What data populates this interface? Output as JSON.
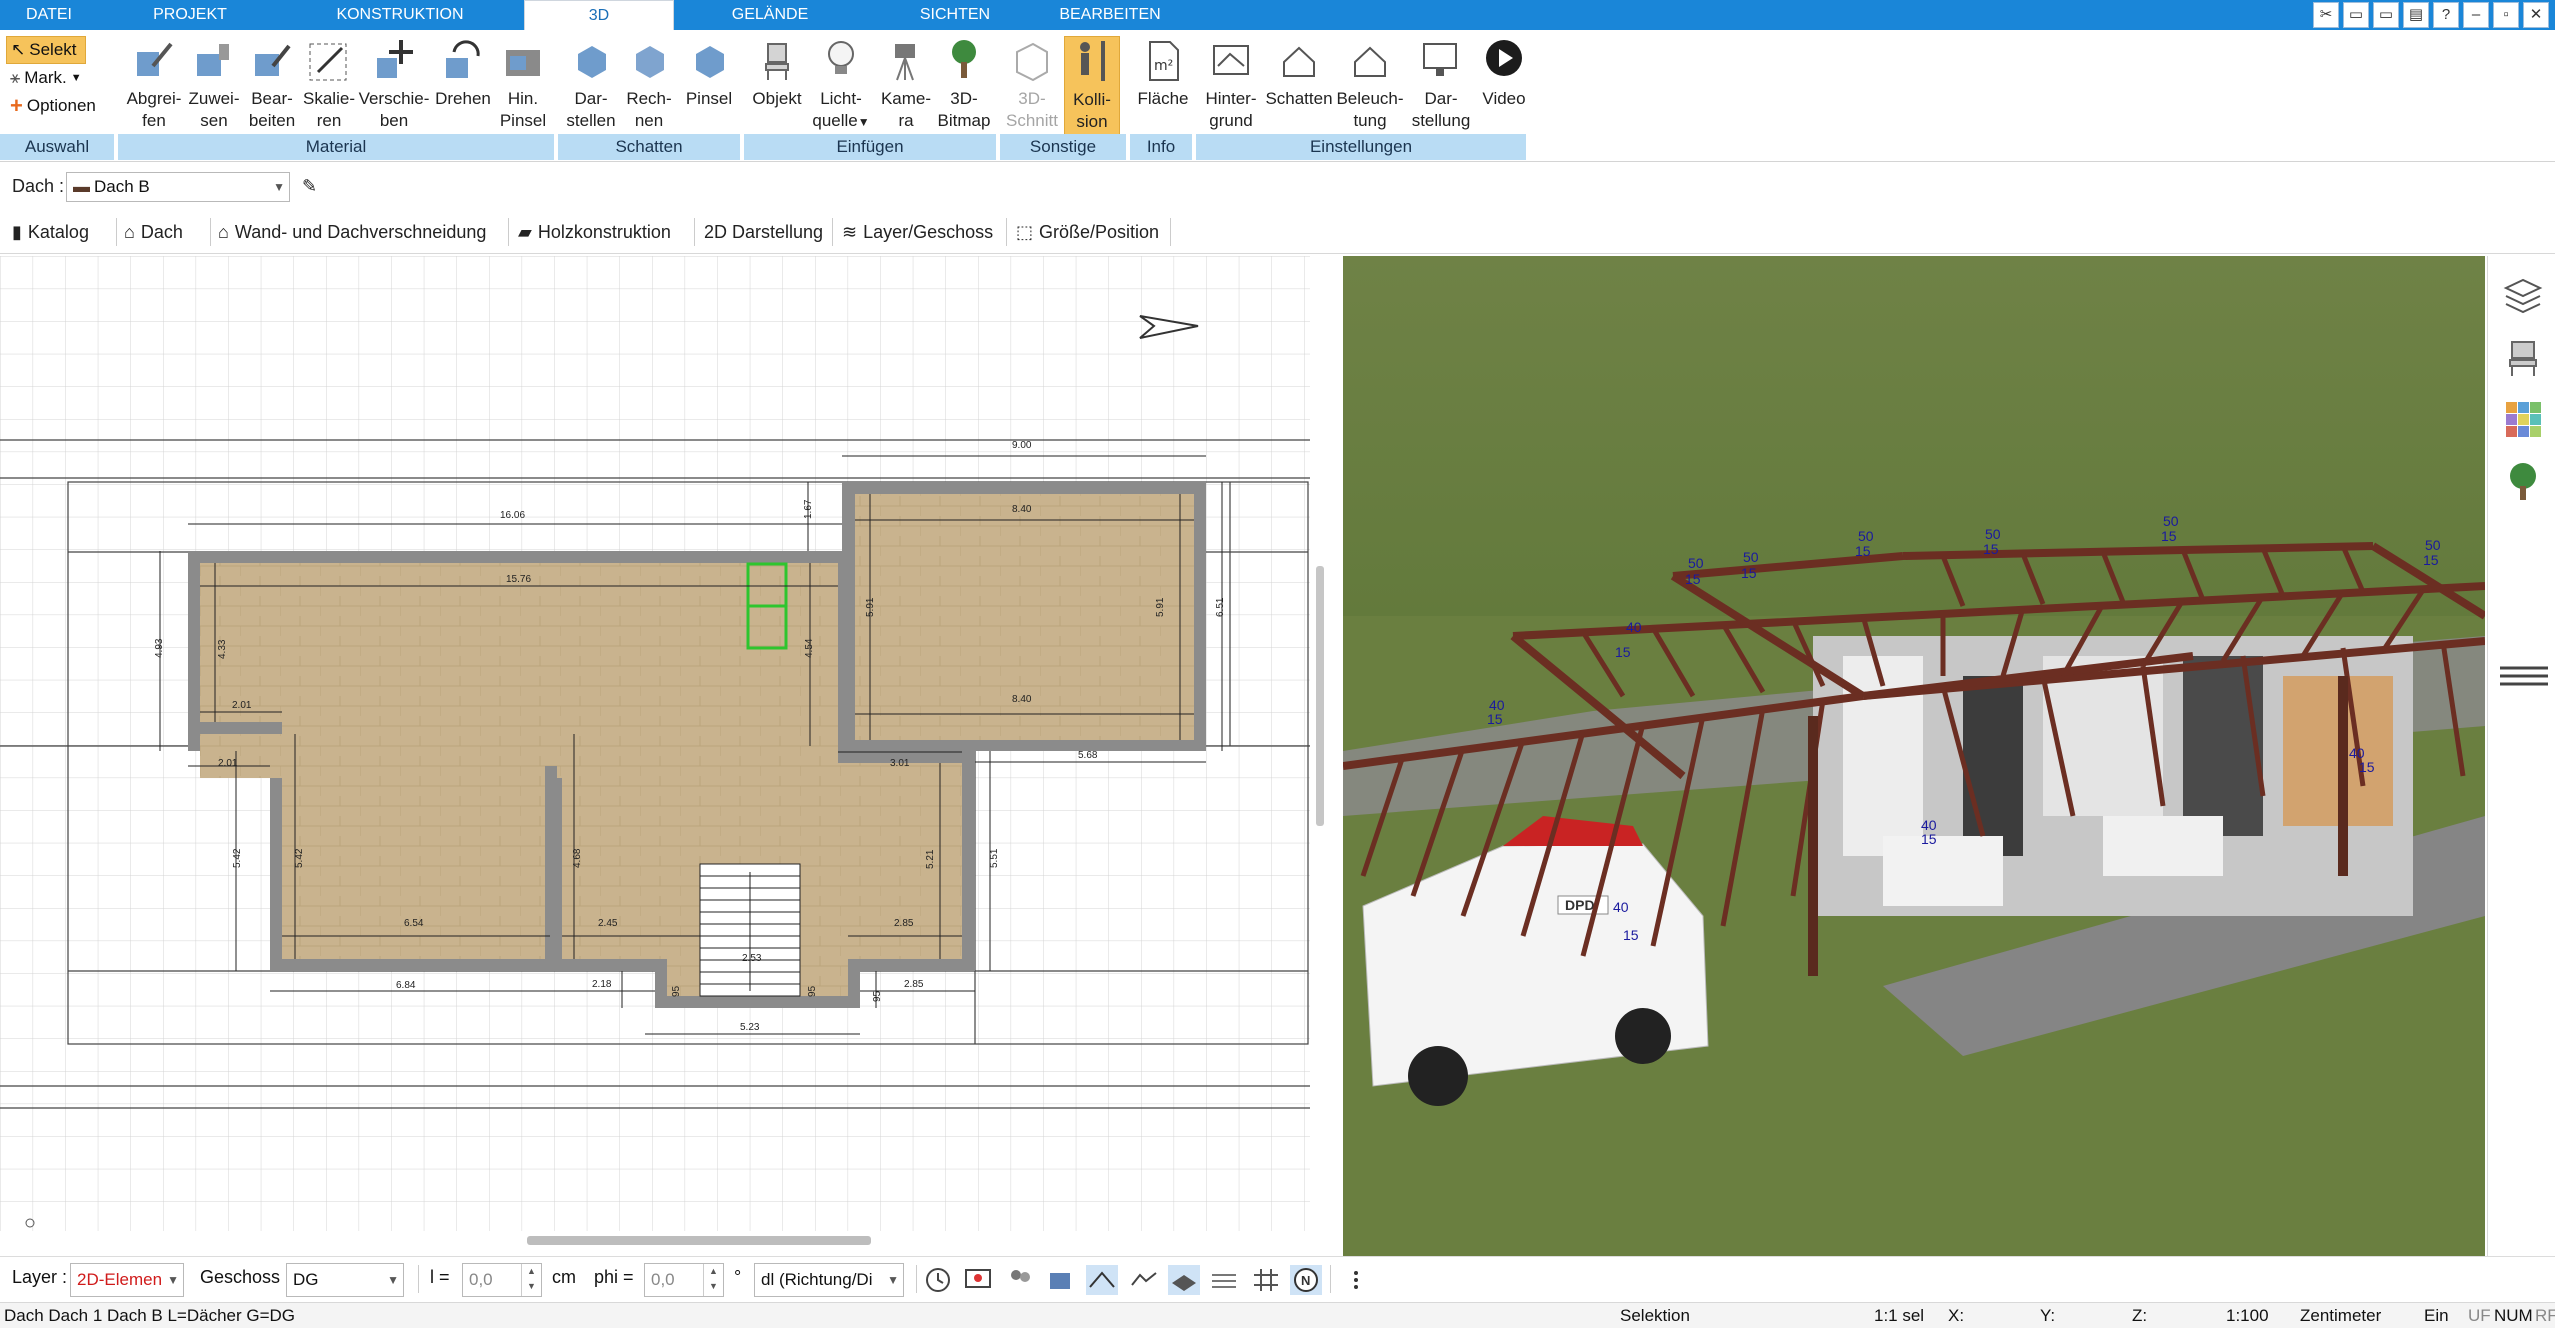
{
  "menu": {
    "tabs": [
      "DATEI",
      "PROJEKT",
      "KONSTRUKTION",
      "3D",
      "GELÄNDE",
      "SICHTEN",
      "BEARBEITEN"
    ],
    "active": "3D"
  },
  "ribbon": {
    "auswahl": {
      "selekt": "Selekt",
      "mark": "Mark.",
      "optionen": "Optionen",
      "group": "Auswahl"
    },
    "material": {
      "group": "Material",
      "buttons": [
        {
          "line1": "Abgrei-",
          "line2": "fen"
        },
        {
          "line1": "Zuwei-",
          "line2": "sen"
        },
        {
          "line1": "Bear-",
          "line2": "beiten"
        },
        {
          "line1": "Skalie-",
          "line2": "ren"
        },
        {
          "line1": "Verschie-",
          "line2": "ben"
        },
        {
          "line1": "Drehen",
          "line2": ""
        },
        {
          "line1": "Hin.",
          "line2": "Pinsel"
        }
      ]
    },
    "schatten": {
      "group": "Schatten",
      "buttons": [
        {
          "line1": "Dar-",
          "line2": "stellen"
        },
        {
          "line1": "Rech-",
          "line2": "nen"
        },
        {
          "line1": "Pinsel",
          "line2": ""
        }
      ]
    },
    "einfuegen": {
      "group": "Einfügen",
      "buttons": [
        {
          "line1": "Objekt",
          "line2": ""
        },
        {
          "line1": "Licht-",
          "line2": "quelle"
        },
        {
          "line1": "Kame-",
          "line2": "ra"
        },
        {
          "line1": "3D-",
          "line2": "Bitmap"
        }
      ]
    },
    "sonstige": {
      "group": "Sonstige",
      "buttons": [
        {
          "line1": "3D-",
          "line2": "Schnitt"
        },
        {
          "line1": "Kolli-",
          "line2": "sion"
        }
      ]
    },
    "info": {
      "group": "Info",
      "buttons": [
        {
          "line1": "Fläche",
          "line2": ""
        }
      ]
    },
    "einstellungen": {
      "group": "Einstellungen",
      "buttons": [
        {
          "line1": "Hinter-",
          "line2": "grund"
        },
        {
          "line1": "Schatten",
          "line2": ""
        },
        {
          "line1": "Beleuch-",
          "line2": "tung"
        },
        {
          "line1": "Dar-",
          "line2": "stellung"
        },
        {
          "line1": "Video",
          "line2": ""
        }
      ]
    }
  },
  "row2": {
    "label": "Dach :",
    "value": "Dach B"
  },
  "row3": {
    "tabs": [
      "Katalog",
      "Dach",
      "Wand- und Dachverschneidung",
      "Holzkonstruktion",
      "2D Darstellung",
      "Layer/Geschoss",
      "Größe/Position"
    ]
  },
  "plan": {
    "dims": [
      "9.00",
      "16.06",
      "1.67",
      "15.76",
      "8.40",
      "4.93",
      "4.33",
      "5.91",
      "5.91",
      "6.51",
      "2.01",
      "2.01",
      "4.54",
      "8.40",
      "3.01",
      "5.68",
      "5.42",
      "5.42",
      "4.68",
      "5.21",
      "5.51",
      "6.54",
      "2.45",
      "2.85",
      "2.53",
      "6.84",
      "2.18",
      "95",
      "95",
      "95",
      "2.85",
      "5.23"
    ]
  },
  "view3d": {
    "labels": [
      "50",
      "15",
      "50",
      "15",
      "50",
      "15",
      "50",
      "15",
      "50",
      "15",
      "50",
      "15",
      "40",
      "15",
      "40",
      "15",
      "40",
      "15",
      "40",
      "15",
      "40",
      "15"
    ],
    "van_brand": "DPD"
  },
  "bottombar": {
    "layer_label": "Layer :",
    "layer_value": "2D-Elemen",
    "geschoss_label": "Geschoss :",
    "geschoss_value": "DG",
    "l_label": "l =",
    "l_value": "0,0",
    "cm": "cm",
    "phi_label": "phi =",
    "phi_value": "0,0",
    "deg": "°",
    "dl_value": "dl (Richtung/Di"
  },
  "status": {
    "left": "Dach Dach 1 Dach B L=Dächer G=DG",
    "mode": "Selektion",
    "sel": "1:1 sel",
    "x": "X:",
    "y": "Y:",
    "z": "Z:",
    "scale": "1:100",
    "unit": "Zentimeter",
    "ein": "Ein",
    "uf": "UF",
    "num": "NUM",
    "rf": "RF"
  },
  "colors": {
    "menubar": "#1a86d8",
    "group": "#b9dcf4",
    "active": "#f6c35b",
    "wall": "#8b8b8b",
    "floor": "#c8b08a",
    "beam": "#6b2e22"
  }
}
